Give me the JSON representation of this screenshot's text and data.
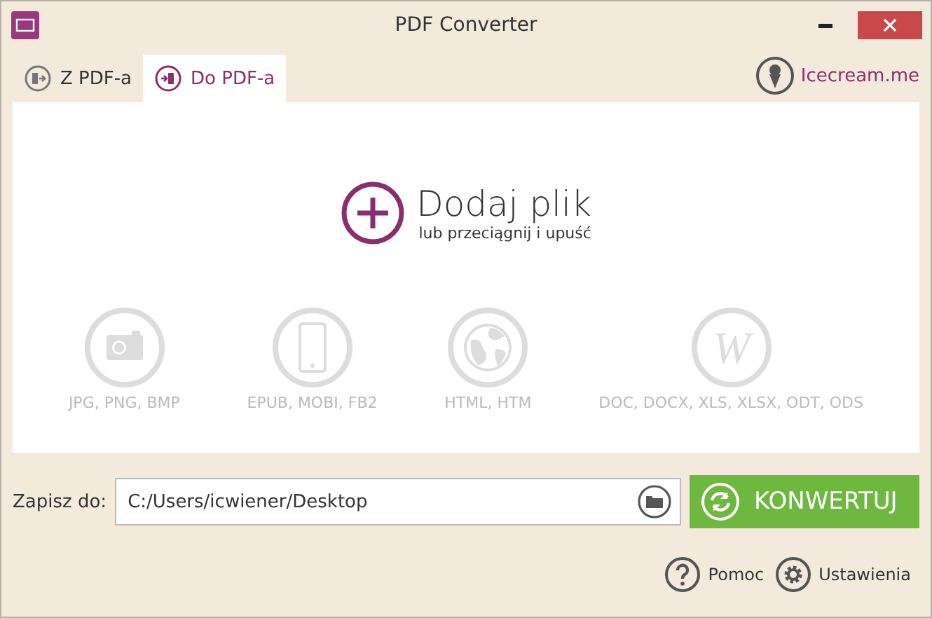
{
  "window": {
    "title": "PDF Converter"
  },
  "tabs": [
    {
      "label": "Z PDF-a",
      "kind": "from",
      "selected": false
    },
    {
      "label": "Do PDF-a",
      "kind": "to",
      "selected": true
    }
  ],
  "brand_link": "Icecream.me",
  "add_file": {
    "title": "Dodaj plik",
    "subtitle": "lub przeciągnij i upuść"
  },
  "formats": [
    {
      "kind": "camera",
      "label": "JPG, PNG, BMP"
    },
    {
      "kind": "phone",
      "label": "EPUB, MOBI, FB2"
    },
    {
      "kind": "globe",
      "label": "HTML, HTM"
    },
    {
      "kind": "letter",
      "glyph": "W",
      "label": "DOC, DOCX, XLS, XLSX, ODT, ODS"
    }
  ],
  "save_to": {
    "label": "Zapisz do:",
    "value": "C:/Users/icwiener/Desktop"
  },
  "convert_button": "KONWERTUJ",
  "footer_links": [
    {
      "kind": "help",
      "label": "Pomoc"
    },
    {
      "kind": "settings",
      "label": "Ustawienia"
    }
  ]
}
